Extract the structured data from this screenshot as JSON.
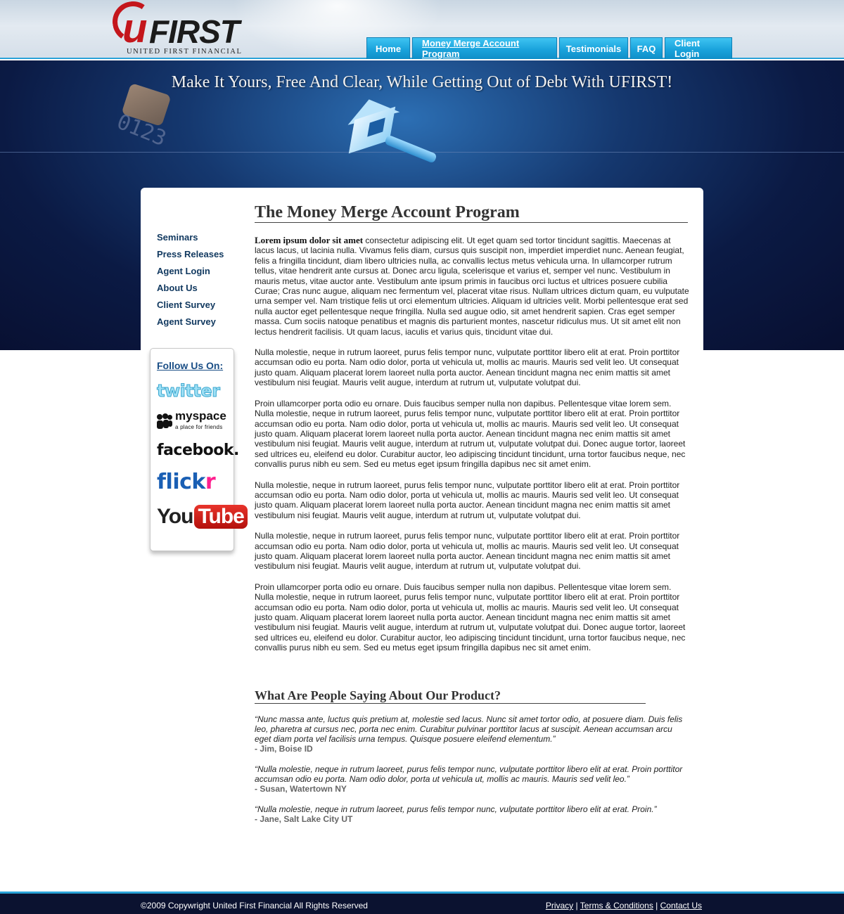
{
  "header": {
    "logo": {
      "u": "u",
      "first": "FIRST",
      "subtitle": "UNITED FIRST FINANCIAL"
    },
    "nav": [
      {
        "label": "Home"
      },
      {
        "label": "Money Merge Account Program"
      },
      {
        "label": "Testimonials"
      },
      {
        "label": "FAQ"
      },
      {
        "label": "Client Login"
      }
    ],
    "active_nav": "Money Merge Account Program"
  },
  "banner": {
    "title": "Make It Yours, Free And Clear, While Getting Out of Debt With UFIRST!",
    "card_number": "0123"
  },
  "sidebar": {
    "links": [
      {
        "label": "Seminars"
      },
      {
        "label": "Press Releases"
      },
      {
        "label": "Agent Login"
      },
      {
        "label": "About Us"
      },
      {
        "label": "Client Survey"
      },
      {
        "label": "Agent Survey"
      }
    ],
    "follow_title": "Follow Us On:",
    "social": {
      "twitter": "twitter",
      "myspace": "myspace",
      "myspace_tagline": "a place for friends",
      "facebook": "facebook.",
      "flickr_a": "flick",
      "flickr_b": "r",
      "youtube_a": "You",
      "youtube_b": "Tube"
    }
  },
  "main": {
    "title": "The Money Merge Account Program",
    "lead": "Lorem ipsum dolor sit amet",
    "p1": " consectetur adipiscing elit. Ut eget quam sed tortor tincidunt sagittis. Maecenas at lacus lacus, ut lacinia nulla. Vivamus felis diam, cursus quis suscipit non, imperdiet imperdiet nunc. Aenean feugiat, felis a fringilla tincidunt, diam libero ultricies nulla, ac convallis lectus metus vehicula urna. In ullamcorper rutrum tellus, vitae hendrerit ante cursus at. Donec arcu ligula, scelerisque et varius et, semper vel nunc. Vestibulum in mauris metus, vitae auctor ante. Vestibulum ante ipsum primis in faucibus orci luctus et ultrices posuere cubilia Curae; Cras nunc augue, aliquam nec fermentum vel, placerat vitae risus. Nullam ultrices dictum quam, eu vulputate urna semper vel. Nam tristique felis ut orci elementum ultricies. Aliquam id ultricies velit. Morbi pellentesque erat sed nulla auctor eget pellentesque neque fringilla. Nulla sed augue odio, sit amet hendrerit sapien. Cras eget semper massa. Cum sociis natoque penatibus et magnis dis parturient montes, nascetur ridiculus mus. Ut sit amet elit non lectus hendrerit facilisis. Ut quam lacus, iaculis et varius quis, tincidunt vitae dui.",
    "p2": "Nulla molestie, neque in rutrum laoreet, purus felis tempor nunc, vulputate porttitor libero elit at erat. Proin porttitor accumsan odio eu porta. Nam odio dolor, porta ut vehicula ut, mollis ac mauris. Mauris sed velit leo. Ut consequat justo quam. Aliquam placerat lorem laoreet nulla porta auctor. Aenean tincidunt magna nec enim mattis sit amet vestibulum nisi feugiat. Mauris velit augue, interdum at rutrum ut, vulputate volutpat dui.",
    "p3": "Proin ullamcorper porta odio eu ornare. Duis faucibus semper nulla non dapibus. Pellentesque vitae lorem sem. Nulla molestie, neque in rutrum laoreet, purus felis tempor nunc, vulputate porttitor libero elit at erat. Proin porttitor accumsan odio eu porta. Nam odio dolor, porta ut vehicula ut, mollis ac mauris. Mauris sed velit leo. Ut consequat justo quam. Aliquam placerat lorem laoreet nulla porta auctor. Aenean tincidunt magna nec enim mattis sit amet vestibulum nisi feugiat. Mauris velit augue, interdum at rutrum ut, vulputate volutpat dui. Donec augue tortor, laoreet sed ultrices eu, eleifend eu dolor. Curabitur auctor, leo adipiscing tincidunt tincidunt, urna tortor faucibus neque, nec convallis purus nibh eu sem. Sed eu metus eget ipsum fringilla dapibus nec sit amet enim.",
    "p4": "Nulla molestie, neque in rutrum laoreet, purus felis tempor nunc, vulputate porttitor libero elit at erat. Proin porttitor accumsan odio eu porta. Nam odio dolor, porta ut vehicula ut, mollis ac mauris. Mauris sed velit leo. Ut consequat justo quam. Aliquam placerat lorem laoreet nulla porta auctor. Aenean tincidunt magna nec enim mattis sit amet vestibulum nisi feugiat. Mauris velit augue, interdum at rutrum ut, vulputate volutpat dui.",
    "p5": "Nulla molestie, neque in rutrum laoreet, purus felis tempor nunc, vulputate porttitor libero elit at erat. Proin porttitor accumsan odio eu porta. Nam odio dolor, porta ut vehicula ut, mollis ac mauris. Mauris sed velit leo. Ut consequat justo quam. Aliquam placerat lorem laoreet nulla porta auctor. Aenean tincidunt magna nec enim mattis sit amet vestibulum nisi feugiat. Mauris velit augue, interdum at rutrum ut, vulputate volutpat dui.",
    "p6": "Proin ullamcorper porta odio eu ornare. Duis faucibus semper nulla non dapibus. Pellentesque vitae lorem sem. Nulla molestie, neque in rutrum laoreet, purus felis tempor nunc, vulputate porttitor libero elit at erat. Proin porttitor accumsan odio eu porta. Nam odio dolor, porta ut vehicula ut, mollis ac mauris. Mauris sed velit leo. Ut consequat justo quam. Aliquam placerat lorem laoreet nulla porta auctor. Aenean tincidunt magna nec enim mattis sit amet vestibulum nisi feugiat. Mauris velit augue, interdum at rutrum ut, vulputate volutpat dui. Donec augue tortor, laoreet sed ultrices eu, eleifend eu dolor. Curabitur auctor, leo adipiscing tincidunt tincidunt, urna tortor faucibus neque, nec convallis purus nibh eu sem. Sed eu metus eget ipsum fringilla dapibus nec sit amet enim."
  },
  "testimonials": {
    "title": "What Are People Saying About Our Product?",
    "items": [
      {
        "quote": "“Nunc massa ante, luctus quis pretium at, molestie sed lacus. Nunc sit amet tortor odio, at posuere diam. Duis felis leo, pharetra at cursus nec, porta nec enim. Curabitur pulvinar porttitor lacus at suscipit. Aenean accumsan arcu eget diam porta vel facilisis urna tempus. Quisque posuere eleifend elementum.”",
        "author": "- Jim, Boise ID"
      },
      {
        "quote": "“Nulla molestie, neque in rutrum laoreet, purus felis tempor nunc, vulputate porttitor libero elit at erat. Proin porttitor accumsan odio eu porta. Nam odio dolor, porta ut vehicula ut, mollis ac mauris. Mauris sed velit leo.”",
        "author": "- Susan, Watertown NY"
      },
      {
        "quote": "“Nulla molestie, neque in rutrum laoreet, purus felis tempor nunc, vulputate porttitor libero elit at erat. Proin.”",
        "author": "- Jane, Salt Lake City UT"
      }
    ]
  },
  "footer": {
    "copyright": "©2009 Copywright United First Financial All Rights Reserved",
    "links": [
      {
        "label": "Privacy"
      },
      {
        "label": "Terms & Conditions"
      },
      {
        "label": "Contact Us"
      }
    ],
    "separator": "|"
  },
  "colors": {
    "brand_red": "#c4161c",
    "nav_blue": "#1aa3dc",
    "banner_navy": "#0b1a44",
    "link_navy": "#10385f"
  }
}
